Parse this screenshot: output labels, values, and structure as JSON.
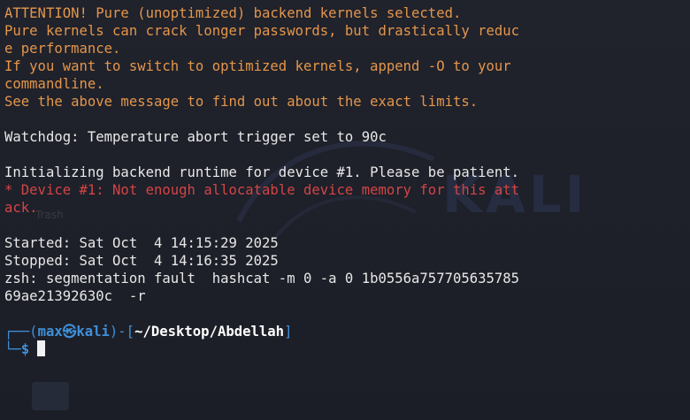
{
  "terminal": {
    "warning_lines": [
      "ATTENTION! Pure (unoptimized) backend kernels selected.",
      "Pure kernels can crack longer passwords, but drastically reduc",
      "e performance.",
      "If you want to switch to optimized kernels, append -O to your",
      "commandline.",
      "See the above message to find out about the exact limits."
    ],
    "watchdog_line": "Watchdog: Temperature abort trigger set to 90c",
    "init_line": "Initializing backend runtime for device #1. Please be patient.",
    "error_lines": [
      "* Device #1: Not enough allocatable device memory for this att",
      "ack."
    ],
    "started_line": "Started: Sat Oct  4 14:15:29 2025",
    "stopped_line": "Stopped: Sat Oct  4 14:16:35 2025",
    "segfault_lines": [
      "zsh: segmentation fault  hashcat -m 0 -a 0 1b0556a757705635785",
      "69ae21392630c  -r"
    ],
    "prompt": {
      "corner_top": "┌──(",
      "user": "max",
      "skull": "㉿",
      "host": "kali",
      "mid": ")-[",
      "path": "~/Desktop/Abdellah",
      "end": "]",
      "corner_bottom": "└─",
      "symbol": "$"
    }
  },
  "wallpaper": {
    "logo_text": "KALI",
    "trash_label": "Trash"
  },
  "colors": {
    "background": "#1e202a",
    "warning": "#e3964a",
    "error": "#d24545",
    "prompt_accent": "#3f8fd8",
    "text": "#e8e8e8"
  }
}
